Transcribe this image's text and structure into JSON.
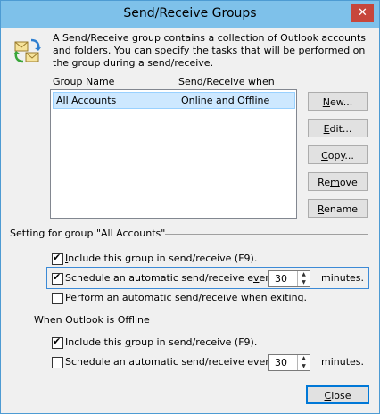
{
  "window": {
    "title": "Send/Receive Groups",
    "close_glyph": "✕"
  },
  "description": "A Send/Receive group contains a collection of Outlook accounts and folders. You can specify the tasks that will be performed on the group during a send/receive.",
  "list": {
    "columns": [
      "Group Name",
      "Send/Receive when"
    ],
    "rows": [
      {
        "name": "All Accounts",
        "when": "Online and Offline",
        "selected": true
      }
    ]
  },
  "buttons": {
    "new_pre": "",
    "new_key": "N",
    "new_post": "ew...",
    "edit_pre": "",
    "edit_key": "E",
    "edit_post": "dit...",
    "copy_pre": "",
    "copy_key": "C",
    "copy_post": "opy...",
    "remove_pre": "Re",
    "remove_key": "m",
    "remove_post": "ove",
    "rename_pre": "",
    "rename_key": "R",
    "rename_post": "ename",
    "close_pre": "",
    "close_key": "C",
    "close_post": "lose"
  },
  "online": {
    "heading": "Setting for group \"All Accounts\"",
    "include_pre": "",
    "include_key": "I",
    "include_post": "nclude this group in send/receive (F9).",
    "include_checked": true,
    "schedule_pre": "Schedule an automatic send/receive e",
    "schedule_key": "v",
    "schedule_post": "ery",
    "schedule_checked": true,
    "schedule_value": "30",
    "minutes": "minutes.",
    "perform_pre": "Perform an automatic send/receive when e",
    "perform_key": "x",
    "perform_post": "iting.",
    "perform_checked": false
  },
  "offline": {
    "heading": "When Outlook is Offline",
    "include_pre": "Include this ",
    "include_key": "g",
    "include_post": "roup in send/receive (F9).",
    "include_checked": true,
    "schedule_pre": "Schedule an automatic send/receive every ",
    "schedule_key": "b",
    "schedule_post": "",
    "schedule_checked": false,
    "schedule_value": "30",
    "minutes": "minutes."
  },
  "icons": {
    "groups": "send-receive-groups-icon",
    "spin_up": "▲",
    "spin_down": "▼"
  }
}
